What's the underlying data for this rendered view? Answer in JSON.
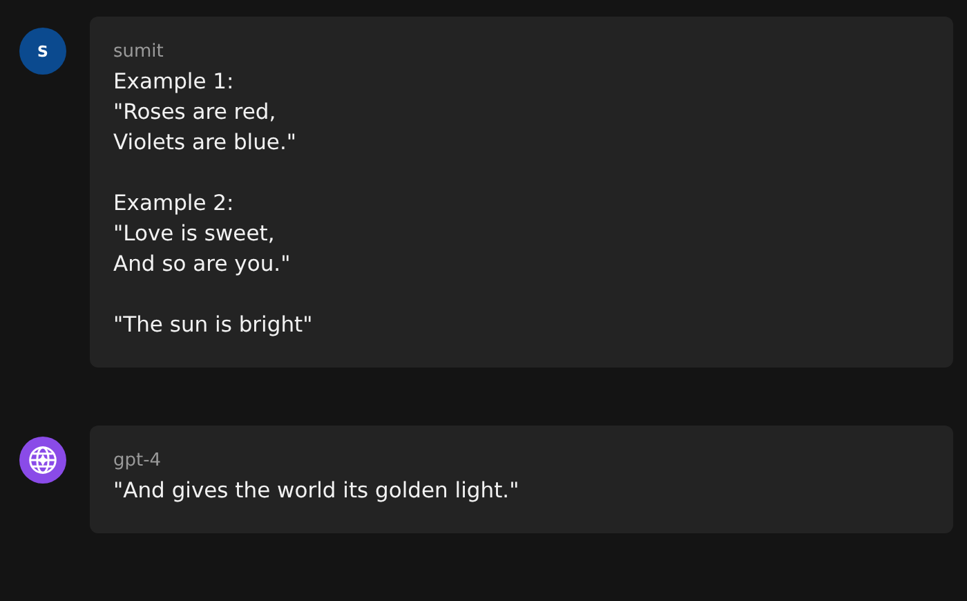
{
  "messages": [
    {
      "author": "sumit",
      "avatar": {
        "kind": "initial",
        "text": "S",
        "color": "#0b4a8f"
      },
      "paragraphs": [
        "Example 1:\n\"Roses are red,\nViolets are blue.\"",
        "Example 2:\n\"Love is sweet,\nAnd so are you.\"",
        "\"The sun is bright\""
      ]
    },
    {
      "author": "gpt-4",
      "avatar": {
        "kind": "icon",
        "color": "#8a4be8"
      },
      "paragraphs": [
        "\"And gives the world its golden light.\""
      ]
    }
  ]
}
